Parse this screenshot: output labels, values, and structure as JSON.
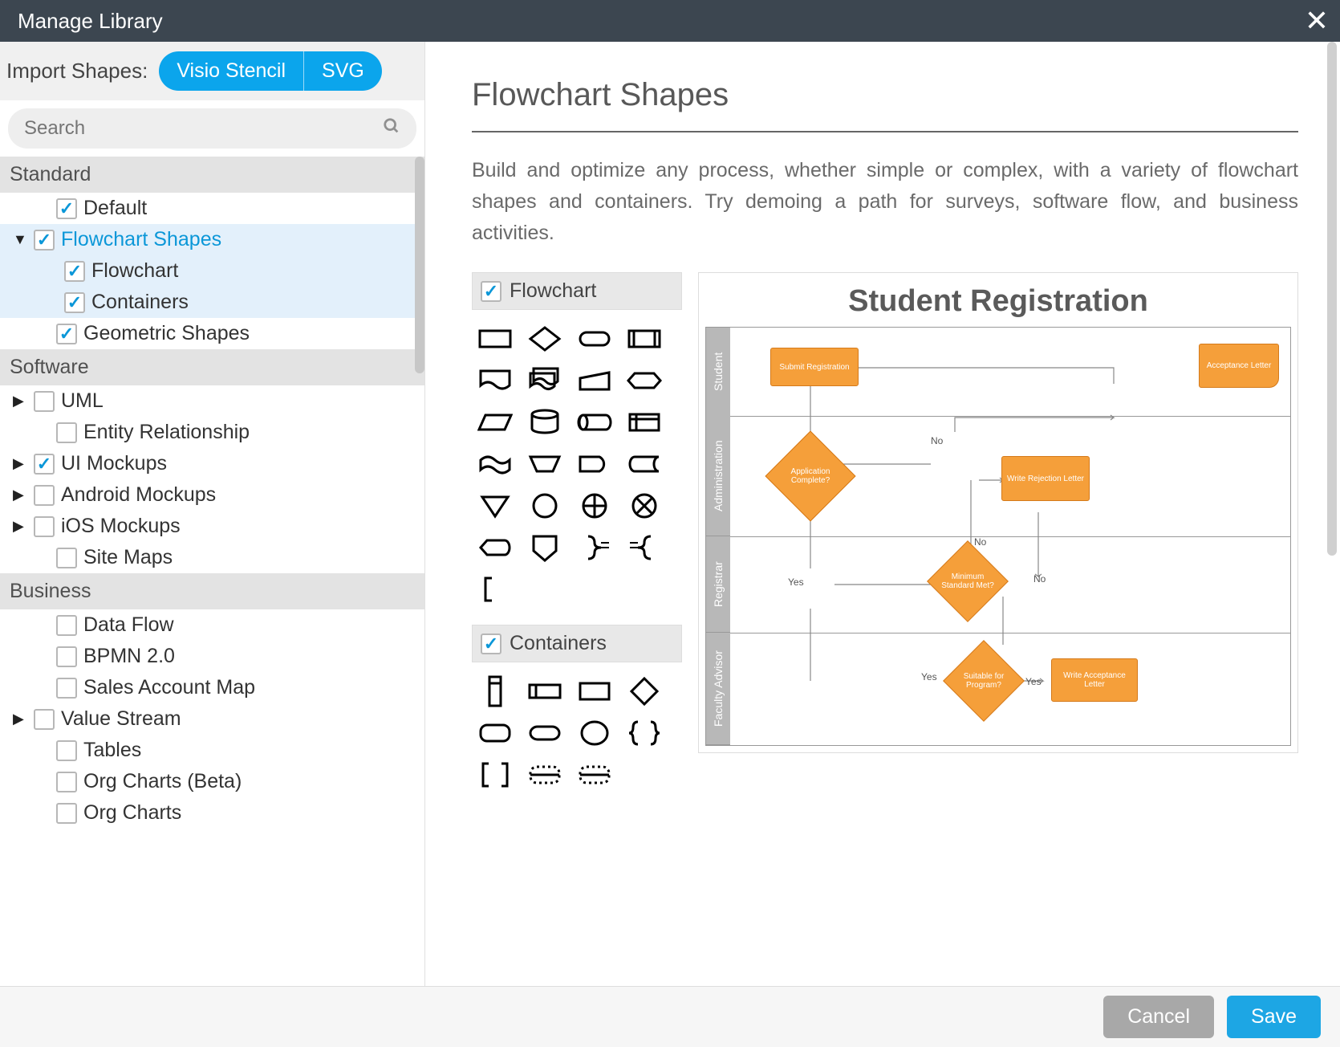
{
  "title": "Manage Library",
  "import_label": "Import Shapes:",
  "import_buttons": {
    "visio": "Visio Stencil",
    "svg": "SVG"
  },
  "search": {
    "placeholder": "Search"
  },
  "categories": {
    "standard": {
      "header": "Standard",
      "items": {
        "default": "Default",
        "flowchart_shapes": "Flowchart Shapes",
        "flowchart": "Flowchart",
        "containers": "Containers",
        "geometric": "Geometric Shapes"
      }
    },
    "software": {
      "header": "Software",
      "items": {
        "uml": "UML",
        "entity": "Entity Relationship",
        "ui_mockups": "UI Mockups",
        "android": "Android Mockups",
        "ios": "iOS Mockups",
        "sitemaps": "Site Maps"
      }
    },
    "business": {
      "header": "Business",
      "items": {
        "dataflow": "Data Flow",
        "bpmn": "BPMN 2.0",
        "sales": "Sales Account Map",
        "valuestream": "Value Stream",
        "tables": "Tables",
        "orgbeta": "Org Charts (Beta)",
        "org": "Org Charts"
      }
    }
  },
  "detail": {
    "title": "Flowchart Shapes",
    "description": "Build and optimize any process, whether simple or complex, with a variety of flowchart shapes and containers. Try demoing a path for surveys, software flow, and business activities.",
    "groups": {
      "flowchart": "Flowchart",
      "containers": "Containers"
    }
  },
  "diagram": {
    "title": "Student Registration",
    "lanes": [
      "Student",
      "Administration",
      "Registrar",
      "Faculty Advisor"
    ],
    "nodes": {
      "submit": "Submit Registration",
      "acceptance_letter": "Acceptance Letter",
      "app_complete": "Application Complete?",
      "rejection": "Write Rejection Letter",
      "min_standard": "Minimum Standard Met?",
      "suitable": "Suitable for Program?",
      "write_accept": "Write Acceptance Letter"
    },
    "edge_labels": {
      "yes": "Yes",
      "no": "No"
    }
  },
  "footer": {
    "cancel": "Cancel",
    "save": "Save"
  }
}
